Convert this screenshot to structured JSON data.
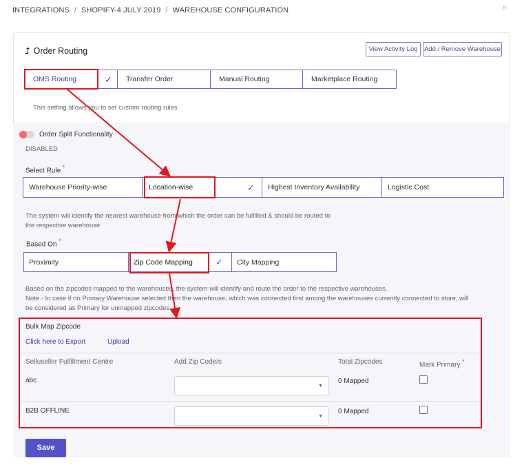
{
  "breadcrumb": {
    "item1": "INTEGRATIONS",
    "item2": "SHOPIFY-4 JULY 2019",
    "item3": "WAREHOUSE CONFIGURATION",
    "separator": "/"
  },
  "close_icon": "×",
  "section": {
    "icon": "routing-arrow-icon",
    "icon_glyph": "⮥",
    "title": "Order Routing"
  },
  "header_buttons": {
    "view_log": "View Activity Log",
    "add_remove": "Add / Remove Warehouse"
  },
  "routing_tabs": [
    "OMS Routing",
    "Transfer Order",
    "Manual Routing",
    "Marketplace Routing"
  ],
  "routing_hint": "This setting allows you to set custom routing rules",
  "check_glyph": "✓",
  "split": {
    "label": "Order Split Functionality",
    "status": "DISABLED"
  },
  "select_rule": {
    "label": "Select Rule",
    "required": "*",
    "options": [
      "Warehouse Priority-wise",
      "Location-wise",
      "Highest Inventory Availability",
      "Logistic Cost"
    ],
    "hint_line1": "The system will identify the nearest warehouse from which the order can be fulfilled & should be routed to",
    "hint_line2": "the respective warehouse"
  },
  "based_on": {
    "label": "Based On",
    "required": "*",
    "options": [
      "Proximity",
      "Zip Code Mapping",
      "City Mapping"
    ],
    "hint_line1": "Based on the zipcodes mapped to the warehouses, the system will identify and route the order to the respective warehouses.",
    "hint_line2": "Note - In case if no Primary Warehouse selected then the warehouse, which was connected first among the warehouses currently connected to store, will",
    "hint_line3": "be considered as Primary for unmapped zipcodes."
  },
  "bulk": {
    "title": "Bulk Map Zipcode",
    "export_link": "Click here to Export",
    "upload_link": "Upload"
  },
  "table": {
    "columns": [
      "Selluseller Fulfillment Centre",
      "Add Zip Code/s",
      "Total Zipcodes",
      "Mark Primary"
    ],
    "required": "*",
    "rows": [
      {
        "centre": "abc",
        "total": "0 Mapped"
      },
      {
        "centre": "B2B OFFLINE",
        "total": "0 Mapped"
      }
    ]
  },
  "caret_glyph": "▼",
  "save_label": "Save",
  "colors": {
    "accent": "#5452c9",
    "annotation_red": "#e0171e",
    "toggle_knob": "#f26b6b"
  }
}
